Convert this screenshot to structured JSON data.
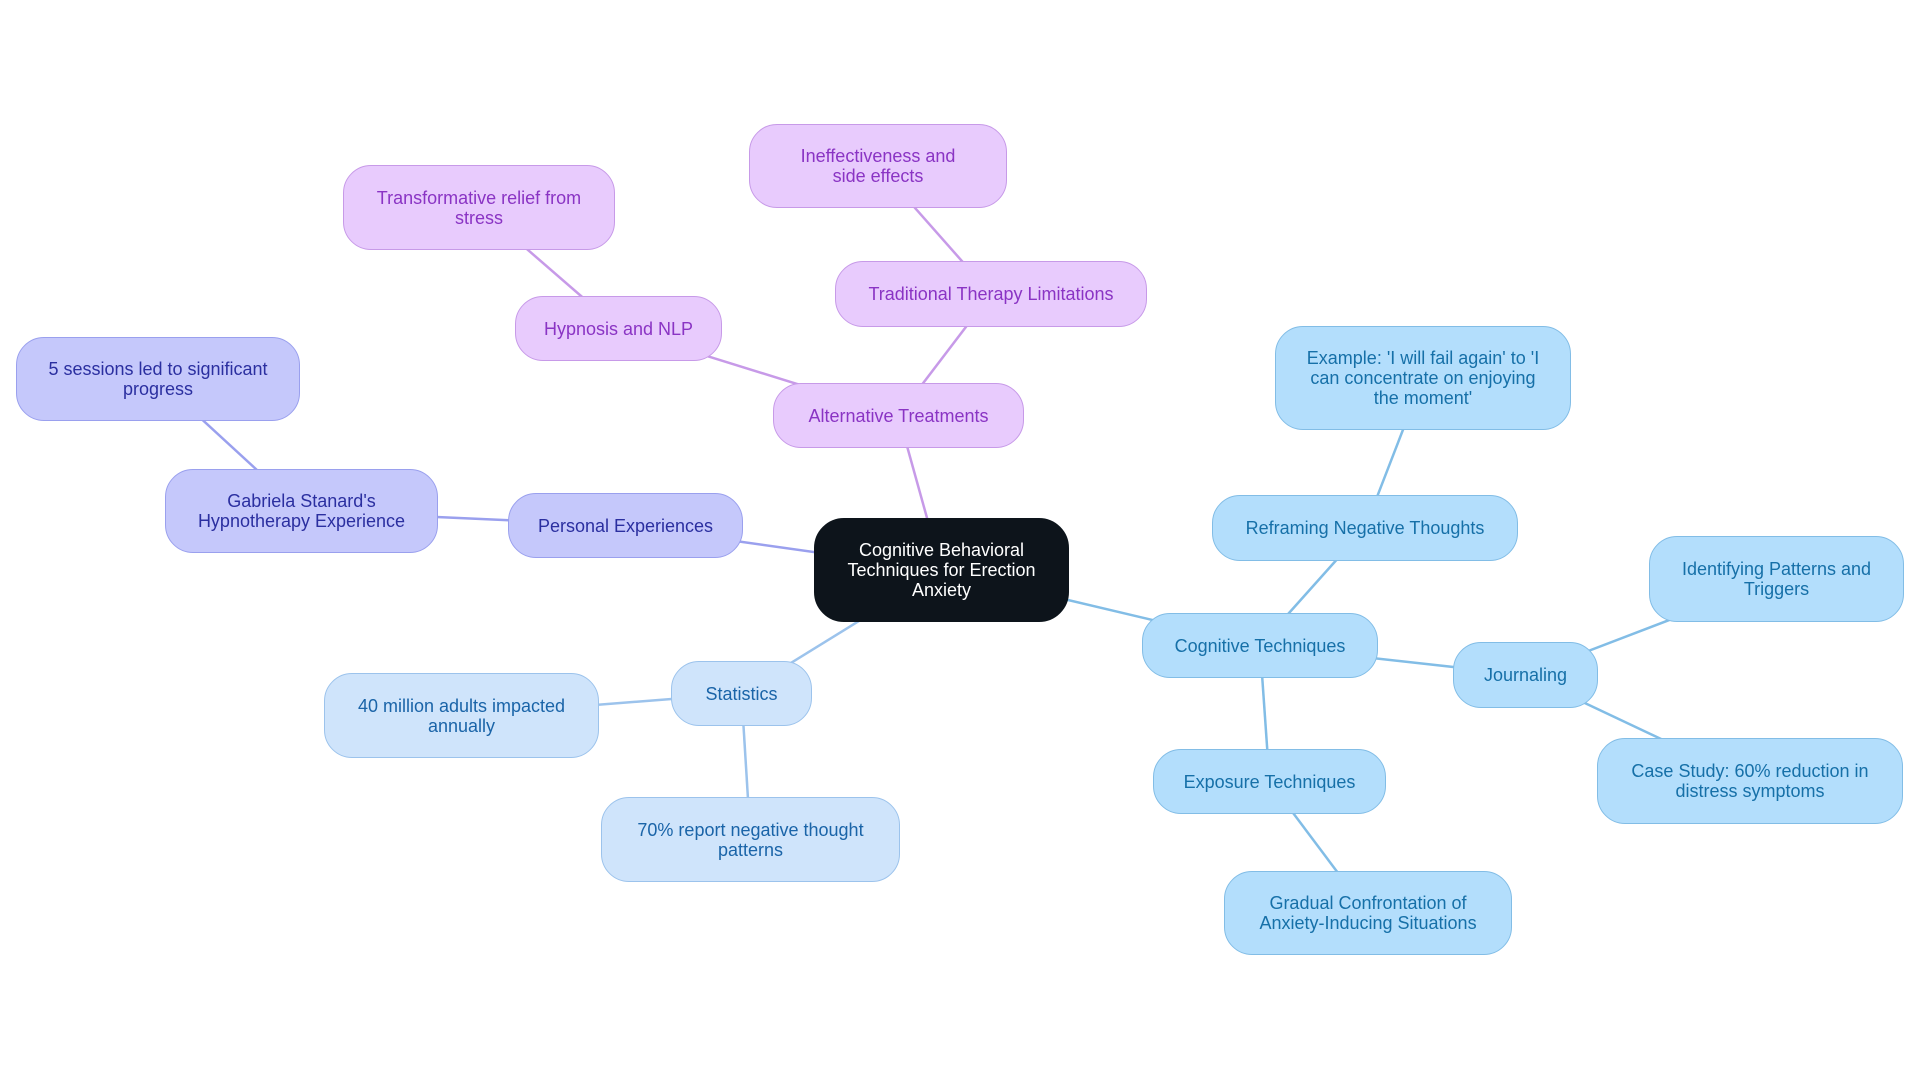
{
  "diagram": {
    "type": "mind-map",
    "colors": {
      "root_bg": "#0d141b",
      "root_text": "#ffffff",
      "alternative_bg": "#e8cbfd",
      "alternative_text": "#8a34c4",
      "alternative_edge": "#c79ae8",
      "personal_bg": "#c5c8fb",
      "personal_text": "#2b2fa0",
      "personal_edge": "#9aa0ee",
      "statistics_bg": "#cfe4fb",
      "statistics_text": "#1a64a8",
      "statistics_edge": "#9cc3ec",
      "cognitive_bg": "#b3defc",
      "cognitive_text": "#1670a8",
      "cognitive_edge": "#82bde6"
    },
    "root": {
      "id": "root",
      "label": "Cognitive Behavioral Techniques for Erection Anxiety"
    },
    "nodes": [
      {
        "id": "alt",
        "parent": "root",
        "branch": "purple",
        "label": "Alternative Treatments"
      },
      {
        "id": "trad",
        "parent": "alt",
        "branch": "purple",
        "label": "Traditional Therapy Limitations"
      },
      {
        "id": "ineff",
        "parent": "trad",
        "branch": "purple",
        "label": "Ineffectiveness and side effects"
      },
      {
        "id": "hyp",
        "parent": "alt",
        "branch": "purple",
        "label": "Hypnosis and NLP"
      },
      {
        "id": "trans",
        "parent": "hyp",
        "branch": "purple",
        "label": "Transformative relief from stress"
      },
      {
        "id": "pers",
        "parent": "root",
        "branch": "indigo",
        "label": "Personal Experiences"
      },
      {
        "id": "gab",
        "parent": "pers",
        "branch": "indigo",
        "label": "Gabriela Stanard's Hypnotherapy Experience"
      },
      {
        "id": "sess",
        "parent": "gab",
        "branch": "indigo",
        "label": "5 sessions led to significant progress"
      },
      {
        "id": "stat",
        "parent": "root",
        "branch": "lightblue",
        "label": "Statistics"
      },
      {
        "id": "forty",
        "parent": "stat",
        "branch": "lightblue",
        "label": "40 million adults impacted annually"
      },
      {
        "id": "seventy",
        "parent": "stat",
        "branch": "lightblue",
        "label": "70% report negative thought patterns"
      },
      {
        "id": "cog",
        "parent": "root",
        "branch": "skyblue",
        "label": "Cognitive Techniques"
      },
      {
        "id": "refr",
        "parent": "cog",
        "branch": "skyblue",
        "label": "Reframing Negative Thoughts"
      },
      {
        "id": "ex",
        "parent": "refr",
        "branch": "skyblue",
        "label": "Example: 'I will fail again' to 'I can concentrate on enjoying the moment'"
      },
      {
        "id": "jour",
        "parent": "cog",
        "branch": "skyblue",
        "label": "Journaling"
      },
      {
        "id": "ident",
        "parent": "jour",
        "branch": "skyblue",
        "label": "Identifying Patterns and Triggers"
      },
      {
        "id": "case",
        "parent": "jour",
        "branch": "skyblue",
        "label": "Case Study: 60% reduction in distress symptoms"
      },
      {
        "id": "expo",
        "parent": "cog",
        "branch": "skyblue",
        "label": "Exposure Techniques"
      },
      {
        "id": "grad",
        "parent": "expo",
        "branch": "skyblue",
        "label": "Gradual Confrontation of Anxiety-Inducing Situations"
      }
    ]
  }
}
